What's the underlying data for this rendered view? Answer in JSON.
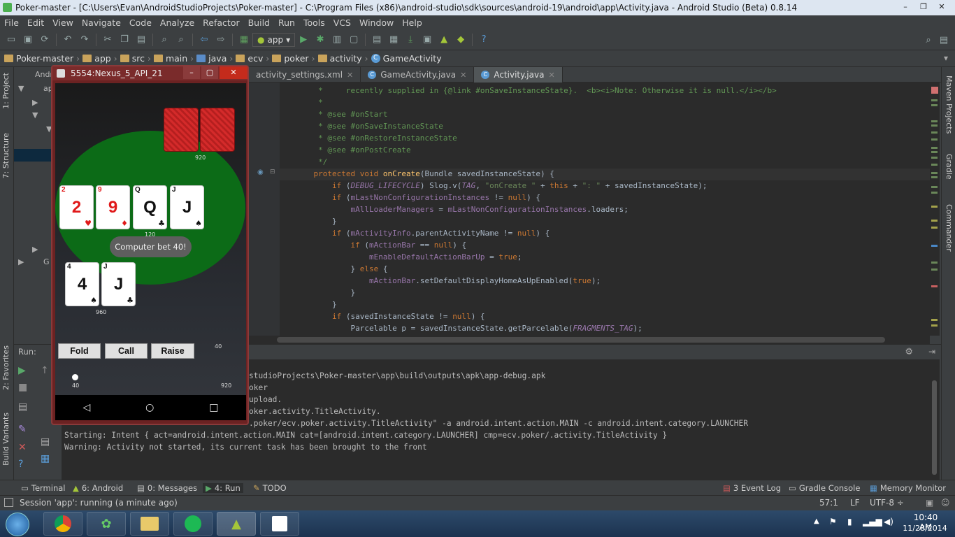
{
  "window": {
    "title": "Poker-master - [C:\\Users\\Evan\\AndroidStudioProjects\\Poker-master] - C:\\Program Files (x86)\\android-studio\\sdk\\sources\\android-19\\android\\app\\Activity.java - Android Studio (Beta) 0.8.14",
    "minimize": "–",
    "maximize": "❐",
    "close": "✕"
  },
  "menu": [
    "File",
    "Edit",
    "View",
    "Navigate",
    "Code",
    "Analyze",
    "Refactor",
    "Build",
    "Run",
    "Tools",
    "VCS",
    "Window",
    "Help"
  ],
  "toolbar": {
    "run_config": "app",
    "help": "?"
  },
  "breadcrumb": [
    "Poker-master",
    "app",
    "src",
    "main",
    "java",
    "ecv",
    "poker",
    "activity",
    "GameActivity"
  ],
  "left_tabs": {
    "project": "1: Project",
    "structure": "7: Structure",
    "favorites": "2: Favorites",
    "build_variants": "Build Variants"
  },
  "right_tabs": {
    "maven": "Maven Projects",
    "gradle": "Gradle",
    "commander": "Commander"
  },
  "project_tree": {
    "row1": "Andr",
    "row2": "ap",
    "row3": "G"
  },
  "editor_tabs": [
    {
      "label": "activity_settings.xml",
      "active": false
    },
    {
      "label": "GameActivity.java",
      "active": false
    },
    {
      "label": "Activity.java",
      "active": true
    }
  ],
  "code_lines": [
    {
      "n": 1,
      "parts": [
        [
          "c",
          "     *     recently supplied in {@link #onSaveInstanceState}.  <b><i>Note: Otherwise it is null.</i></b>"
        ]
      ]
    },
    {
      "n": 2,
      "parts": [
        [
          "c",
          "     *"
        ]
      ]
    },
    {
      "n": 3,
      "parts": [
        [
          "c",
          "     * @see #onStart"
        ]
      ]
    },
    {
      "n": 4,
      "parts": [
        [
          "c",
          "     * @see #onSaveInstanceState"
        ]
      ]
    },
    {
      "n": 5,
      "parts": [
        [
          "c",
          "     * @see #onRestoreInstanceState"
        ]
      ]
    },
    {
      "n": 6,
      "parts": [
        [
          "c",
          "     * @see #onPostCreate"
        ]
      ]
    },
    {
      "n": 7,
      "parts": [
        [
          "c",
          "     */"
        ]
      ]
    },
    {
      "n": 8,
      "parts": [
        [
          "k",
          "    protected void "
        ],
        [
          "f",
          "onCreate"
        ],
        [
          "",
          "(Bundle savedInstanceState) {"
        ]
      ]
    },
    {
      "n": 9,
      "parts": [
        [
          "k",
          "        if "
        ],
        [
          "",
          "("
        ],
        [
          "vi",
          "DEBUG_LIFECYCLE"
        ],
        [
          "",
          ") Slog.v("
        ],
        [
          "vi",
          "TAG"
        ],
        [
          "",
          ", "
        ],
        [
          "s",
          "\"onCreate \""
        ],
        [
          "",
          " + "
        ],
        [
          "k",
          "this"
        ],
        [
          "",
          " + "
        ],
        [
          "s",
          "\": \""
        ],
        [
          "",
          " + savedInstanceState);"
        ]
      ]
    },
    {
      "n": 10,
      "parts": [
        [
          "k",
          "        if "
        ],
        [
          "",
          "("
        ],
        [
          "v",
          "mLastNonConfigurationInstances"
        ],
        [
          "",
          " != "
        ],
        [
          "k",
          "null"
        ],
        [
          "",
          ") {"
        ]
      ]
    },
    {
      "n": 11,
      "parts": [
        [
          "",
          "            "
        ],
        [
          "v",
          "mAllLoaderManagers"
        ],
        [
          "",
          " = "
        ],
        [
          "v",
          "mLastNonConfigurationInstances"
        ],
        [
          "",
          ".loaders;"
        ]
      ]
    },
    {
      "n": 12,
      "parts": [
        [
          "",
          "        }"
        ]
      ]
    },
    {
      "n": 13,
      "parts": [
        [
          "k",
          "        if "
        ],
        [
          "",
          "("
        ],
        [
          "v",
          "mActivityInfo"
        ],
        [
          "",
          ".parentActivityName != "
        ],
        [
          "k",
          "null"
        ],
        [
          "",
          ") {"
        ]
      ]
    },
    {
      "n": 14,
      "parts": [
        [
          "k",
          "            if "
        ],
        [
          "",
          "("
        ],
        [
          "v",
          "mActionBar"
        ],
        [
          "",
          " == "
        ],
        [
          "k",
          "null"
        ],
        [
          "",
          ") {"
        ]
      ]
    },
    {
      "n": 15,
      "parts": [
        [
          "",
          "                "
        ],
        [
          "v",
          "mEnableDefaultActionBarUp"
        ],
        [
          "",
          " = "
        ],
        [
          "k",
          "true"
        ],
        [
          "",
          ";"
        ]
      ]
    },
    {
      "n": 16,
      "parts": [
        [
          "",
          "            } "
        ],
        [
          "k",
          "else "
        ],
        [
          "",
          "{"
        ]
      ]
    },
    {
      "n": 17,
      "parts": [
        [
          "",
          "                "
        ],
        [
          "v",
          "mActionBar"
        ],
        [
          "",
          ".setDefaultDisplayHomeAsUpEnabled("
        ],
        [
          "k",
          "true"
        ],
        [
          "",
          ");"
        ]
      ]
    },
    {
      "n": 18,
      "parts": [
        [
          "",
          "            }"
        ]
      ]
    },
    {
      "n": 19,
      "parts": [
        [
          "",
          "        }"
        ]
      ]
    },
    {
      "n": 20,
      "parts": [
        [
          "k",
          "        if "
        ],
        [
          "",
          "(savedInstanceState != "
        ],
        [
          "k",
          "null"
        ],
        [
          "",
          ") {"
        ]
      ]
    },
    {
      "n": 21,
      "parts": [
        [
          "",
          "            Parcelable p = savedInstanceState.getParcelable("
        ],
        [
          "vi",
          "FRAGMENTS_TAG"
        ],
        [
          "",
          ");"
        ]
      ]
    }
  ],
  "run_panel": {
    "label": "Run:",
    "console": [
      "studioProjects\\Poker-master\\app\\build\\outputs\\apk\\app-debug.apk",
      "oker",
      "upload.",
      "oker.activity.TitleActivity.",
      ".poker/ecv.poker.activity.TitleActivity\" -a android.intent.action.MAIN -c android.intent.category.LAUNCHER",
      "Starting: Intent { act=android.intent.action.MAIN cat=[android.intent.category.LAUNCHER] cmp=ecv.poker/.activity.TitleActivity }",
      "Warning: Activity not started, its current task has been brought to the front"
    ]
  },
  "bottom_tabs": {
    "terminal": "Terminal",
    "android": "6: Android",
    "messages": "0: Messages",
    "run": "4: Run",
    "todo": "TODO",
    "event_log": "3 Event Log",
    "gradle_console": "Gradle Console",
    "memory_monitor": "Memory Monitor"
  },
  "status": {
    "message": "Session 'app': running (a minute ago)",
    "position": "57:1",
    "line_sep": "LF",
    "encoding": "UTF-8 ÷"
  },
  "emulator": {
    "title": "5554:Nexus_5_API_21",
    "opponent_chips": "920",
    "community_chips": "120",
    "player_chips": "960",
    "toast": "Computer bet 40!",
    "community_cards": [
      {
        "rank": "2",
        "suit": "♥",
        "color": "red"
      },
      {
        "rank": "9",
        "suit": "♦",
        "color": "red"
      },
      {
        "rank": "Q",
        "suit": "♣",
        "color": "blk"
      },
      {
        "rank": "J",
        "suit": "♠",
        "color": "blk"
      }
    ],
    "player_cards": [
      {
        "rank": "4",
        "suit": "♠",
        "color": "blk"
      },
      {
        "rank": "J",
        "suit": "♣",
        "color": "blk"
      }
    ],
    "buttons": {
      "fold": "Fold",
      "call": "Call",
      "raise": "Raise"
    },
    "bet_amount": "40",
    "slider_min": "40",
    "slider_max": "920",
    "nav": {
      "back": "◁",
      "home": "○",
      "recent": "□"
    }
  },
  "taskbar": {
    "time": "10:40 AM",
    "date": "11/28/2014"
  },
  "colors": {
    "editor_bg": "#2b2b2b",
    "ide_bg": "#3c3f41",
    "table_green": "#0c6b17",
    "card_back": "#d42a2a"
  }
}
